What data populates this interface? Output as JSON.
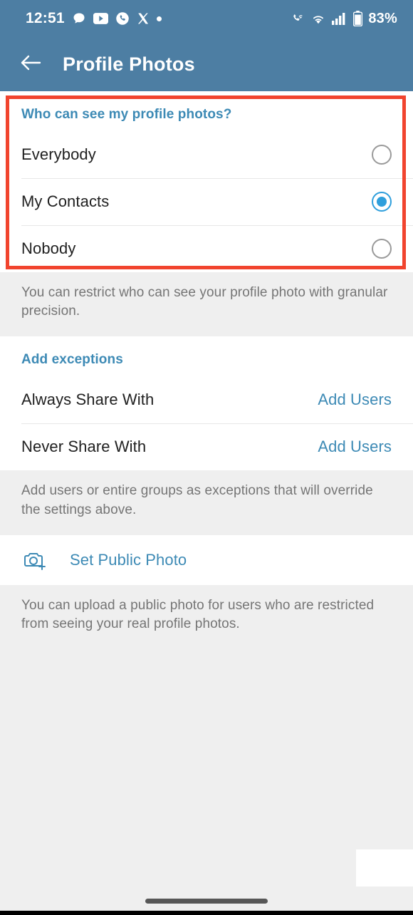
{
  "status_bar": {
    "time": "12:51",
    "left_icons": [
      "message-bubble-icon",
      "youtube-icon",
      "phone-call-icon",
      "x-twitter-icon",
      "dot-icon"
    ],
    "right_icons": [
      "call-wifi-icon",
      "wifi-icon",
      "cellular-signal-icon",
      "battery-icon"
    ],
    "battery_percent": "83%"
  },
  "app_bar": {
    "back_icon": "arrow-left-icon",
    "title": "Profile Photos"
  },
  "visibility_section": {
    "heading": "Who can see my profile photos?",
    "options": [
      {
        "label": "Everybody",
        "selected": false
      },
      {
        "label": "My Contacts",
        "selected": true
      },
      {
        "label": "Nobody",
        "selected": false
      }
    ],
    "footnote": "You can restrict who can see your profile photo with granular precision."
  },
  "exceptions_section": {
    "heading": "Add exceptions",
    "rows": [
      {
        "label": "Always Share With",
        "action": "Add Users"
      },
      {
        "label": "Never Share With",
        "action": "Add Users"
      }
    ],
    "footnote": "Add users or entire groups as exceptions that will override the settings above."
  },
  "public_photo_section": {
    "icon": "camera-plus-icon",
    "label": "Set Public Photo",
    "footnote": "You can upload a public photo for users who are restricted from seeing your real profile photos."
  },
  "colors": {
    "header_bg": "#4d7ea3",
    "accent_blue": "#3d8ab5",
    "radio_selected": "#2f9fdc",
    "highlight_red": "#f1442e",
    "page_bg": "#efefef"
  }
}
